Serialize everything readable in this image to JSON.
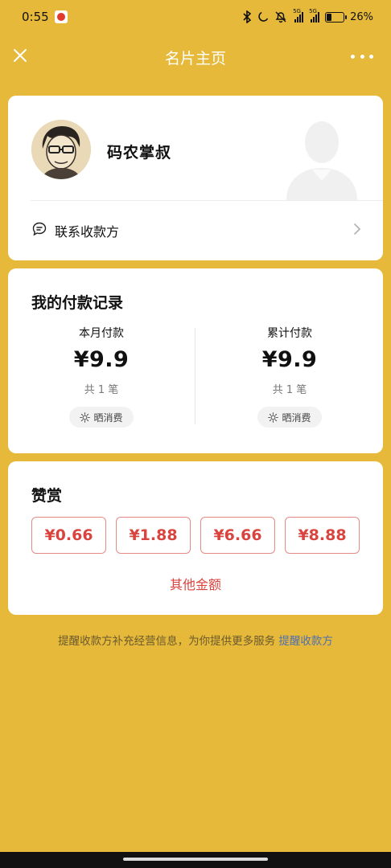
{
  "status_bar": {
    "time": "0:55",
    "battery": "26%",
    "network_tag_1": "5G",
    "network_tag_2": "5G",
    "icons": [
      "bluetooth-icon",
      "moon-icon",
      "mute-icon",
      "signal-icon",
      "battery-icon"
    ]
  },
  "nav": {
    "title": "名片主页",
    "title_color": "#FFFFFF",
    "background": "#E6B93A"
  },
  "profile": {
    "name": "码农掌叔",
    "contact_label": "联系收款方"
  },
  "records": {
    "title": "我的付款记录",
    "month": {
      "label": "本月付款",
      "amount": "¥9.9",
      "count": "共 1 笔",
      "share_label": "晒消费"
    },
    "total": {
      "label": "累计付款",
      "amount": "¥9.9",
      "count": "共 1 笔",
      "share_label": "晒消费"
    }
  },
  "reward": {
    "title": "赞赏",
    "amounts": [
      "¥0.66",
      "¥1.88",
      "¥6.66",
      "¥8.88"
    ],
    "other_label": "其他金额",
    "accent": "#D9443E"
  },
  "footer": {
    "note": "提醒收款方补充经营信息，为你提供更多服务",
    "link": "提醒收款方"
  }
}
